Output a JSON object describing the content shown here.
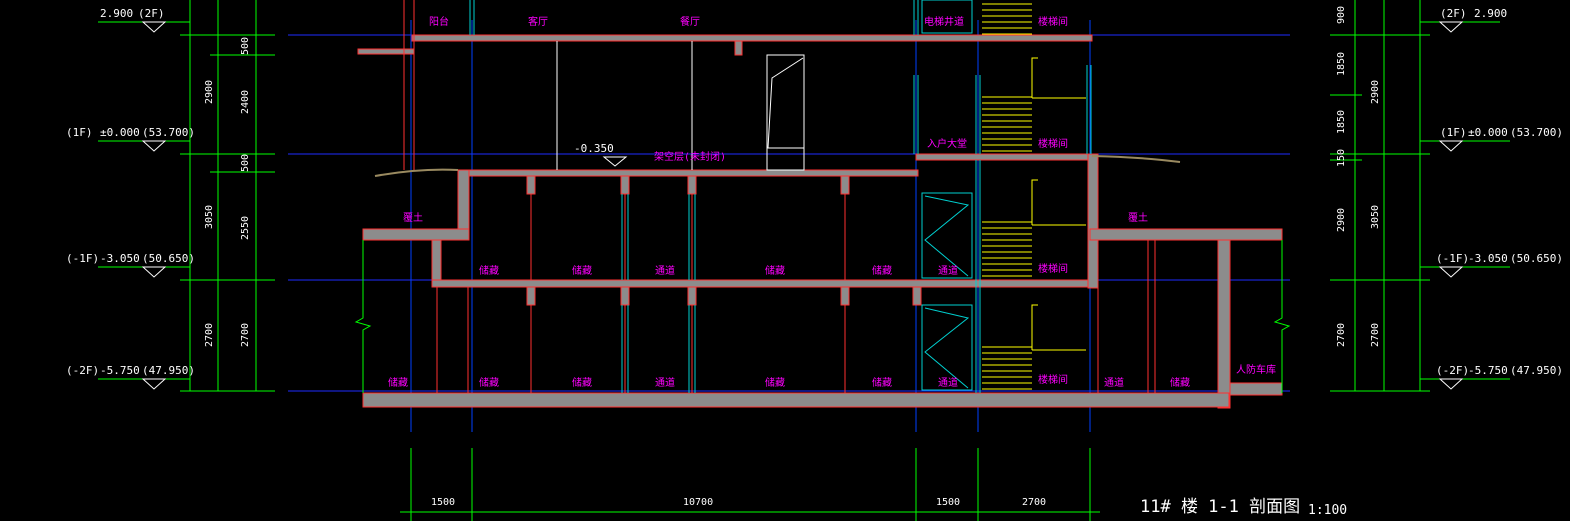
{
  "drawing": {
    "title": "11# 楼 1-1 剖面图",
    "scale": "1:100"
  },
  "levels": {
    "left": [
      {
        "floor": "(2F)",
        "elev": "2.900",
        "abs": ""
      },
      {
        "floor": "(1F)",
        "elev": "±0.000",
        "abs": "(53.700)"
      },
      {
        "floor": "(-1F)",
        "elev": "-3.050",
        "abs": "(50.650)"
      },
      {
        "floor": "(-2F)",
        "elev": "-5.750",
        "abs": "(47.950)"
      }
    ],
    "right": [
      {
        "floor": "(2F)",
        "elev": "2.900",
        "abs": ""
      },
      {
        "floor": "(1F)",
        "elev": "±0.000",
        "abs": "(53.700)"
      },
      {
        "floor": "(-1F)",
        "elev": "-3.050",
        "abs": "(50.650)"
      },
      {
        "floor": "(-2F)",
        "elev": "-5.750",
        "abs": "(47.950)"
      }
    ],
    "interior_elev": "-0.350"
  },
  "dims_left": {
    "outer": [
      "2900",
      "3050",
      "2700"
    ],
    "inner": [
      "500",
      "2400",
      "500",
      "2550",
      "2700"
    ]
  },
  "dims_right": {
    "outer": [
      "2900",
      "3050",
      "2700"
    ],
    "inner": [
      "900",
      "1850",
      "1850",
      "150",
      "2900",
      "2700"
    ]
  },
  "dims_bottom": [
    "1500",
    "10700",
    "1500",
    "2700"
  ],
  "rooms": {
    "f2": [
      "阳台",
      "客厅",
      "餐厅",
      "电梯井道",
      "楼梯间"
    ],
    "f1": [
      "入户大堂",
      "楼梯间",
      "架空层(未封闭)"
    ],
    "soil": [
      "覆土",
      "覆土"
    ],
    "b1": [
      "储藏",
      "储藏",
      "通道",
      "储藏",
      "储藏",
      "通道",
      "楼梯间"
    ],
    "b2": [
      "储藏",
      "储藏",
      "储藏",
      "通道",
      "储藏",
      "储藏",
      "通道",
      "楼梯间",
      "通道",
      "储藏",
      "人防车库"
    ]
  },
  "colors": {
    "level_line": "#1e2bff",
    "dim_line": "#00ff00",
    "wall_fill": "#8c8c8c",
    "wall_edge": "#ff3030",
    "stair": "#ffff00",
    "glazing": "#00d0d0",
    "room_label": "#ff00ff",
    "axis": "#0040ff"
  }
}
